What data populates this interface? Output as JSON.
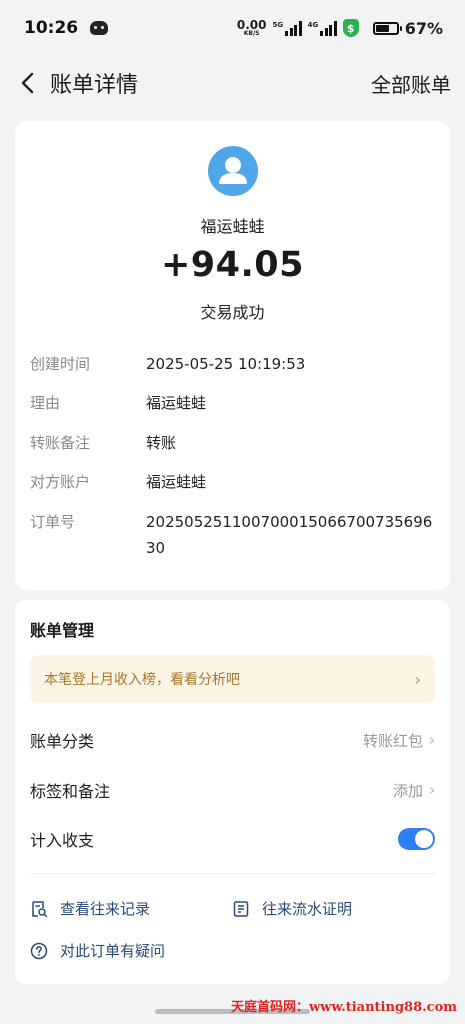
{
  "status_bar": {
    "time": "10:26",
    "speed_value": "0.00",
    "speed_unit": "KB/S",
    "net1": "5G",
    "net2": "4G",
    "shield_glyph": "$",
    "battery_level": 0.67,
    "battery_pct": "67%"
  },
  "header": {
    "title": "账单详情",
    "all_bills": "全部账单"
  },
  "transaction": {
    "name": "福运蛙蛙",
    "amount": "+94.05",
    "status": "交易成功"
  },
  "details": [
    {
      "key": "创建时间",
      "value": "2025-05-25 10:19:53"
    },
    {
      "key": "理由",
      "value": "福运蛙蛙"
    },
    {
      "key": "转账备注",
      "value": "转账"
    },
    {
      "key": "对方账户",
      "value": "福运蛙蛙"
    },
    {
      "key": "订单号",
      "value": "20250525110070001506670073569630"
    }
  ],
  "management": {
    "title": "账单管理",
    "banner": "本笔登上月收入榜，看看分析吧",
    "category_label": "账单分类",
    "category_value": "转账红包",
    "tags_label": "标签和备注",
    "tags_value": "添加",
    "include_label": "计入收支",
    "include_on": true,
    "link_records": "查看往来记录",
    "link_proof": "往来流水证明",
    "link_question": "对此订单有疑问"
  },
  "watermark": "天庭首码网：www.tianting88.com",
  "colors": {
    "accent": "#2f7ef5",
    "avatar": "#4fa6e8",
    "banner_bg": "#fcf5e6",
    "banner_text": "#a9752a",
    "link": "#2a4a7a",
    "watermark": "#e0241f"
  }
}
